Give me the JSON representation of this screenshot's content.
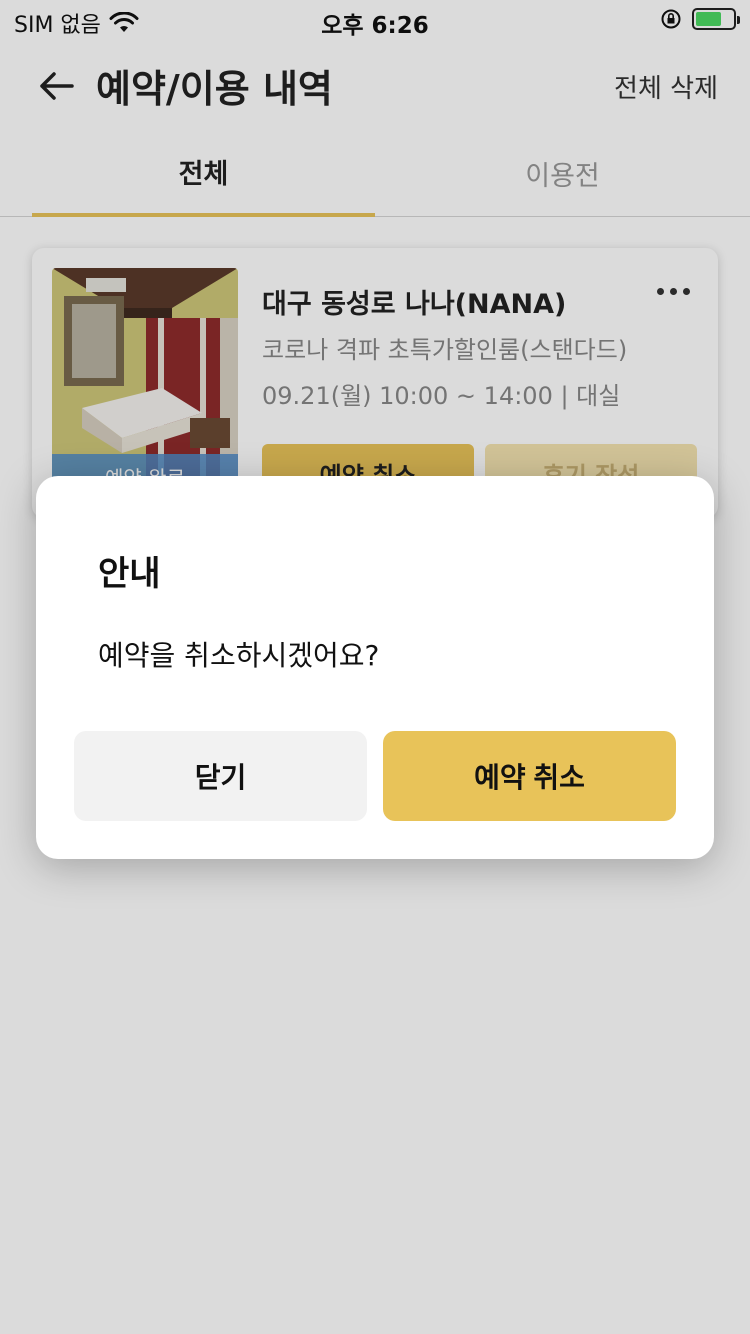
{
  "status_bar": {
    "carrier": "SIM 없음",
    "time": "오후 6:26"
  },
  "header": {
    "title": "예약/이용 내역",
    "delete_all": "전체 삭제"
  },
  "tabs": [
    {
      "label": "전체",
      "active": true
    },
    {
      "label": "이용전",
      "active": false
    }
  ],
  "reservation": {
    "status_badge": "예약 완료",
    "hotel_name": "대구 동성로 나나(NANA)",
    "room_name": "코로나 격파 초특가할인룸(스탠다드)",
    "schedule": "09.21(월) 10:00 ~ 14:00 | 대실",
    "cancel_button": "예약 취소",
    "review_button": "후기 작성"
  },
  "dialog": {
    "title": "안내",
    "message": "예약을 취소하시겠어요?",
    "close_button": "닫기",
    "confirm_button": "예약 취소"
  },
  "colors": {
    "accent": "#e8c359",
    "tab_indicator": "#e8c359",
    "status_badge_bg": "#508cc8"
  },
  "icons": {
    "back": "arrow-left-icon",
    "more": "more-dots-icon",
    "wifi": "wifi-icon",
    "battery": "battery-charging-icon",
    "rotation_lock": "rotation-lock-icon"
  }
}
